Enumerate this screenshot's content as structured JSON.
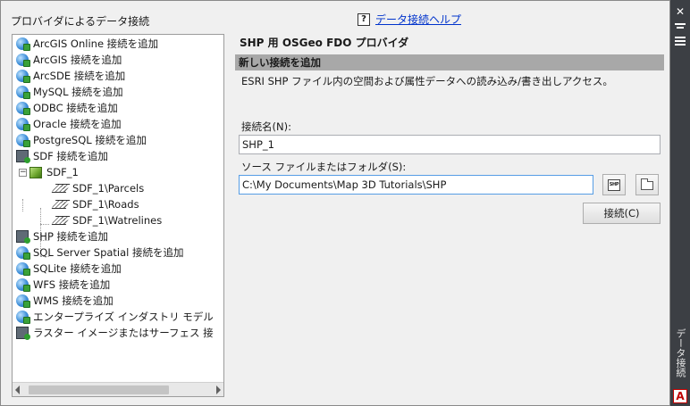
{
  "providers_label": "プロバイダによるデータ接続",
  "help_link": "データ接続ヘルプ",
  "tree": {
    "items": [
      {
        "label": "ArcGIS Online 接続を追加",
        "icon": "globe-icon"
      },
      {
        "label": "ArcGIS 接続を追加",
        "icon": "globe-icon"
      },
      {
        "label": "ArcSDE 接続を追加",
        "icon": "globe-icon"
      },
      {
        "label": "MySQL 接続を追加",
        "icon": "globe-icon"
      },
      {
        "label": "ODBC 接続を追加",
        "icon": "globe-icon"
      },
      {
        "label": "Oracle 接続を追加",
        "icon": "globe-icon"
      },
      {
        "label": "PostgreSQL 接続を追加",
        "icon": "globe-icon"
      },
      {
        "label": "SDF 接続を追加",
        "icon": "database-icon"
      },
      {
        "label": "SDF_1",
        "icon": "cube-icon"
      },
      {
        "label": "SDF_1\\Parcels",
        "icon": "layer-icon"
      },
      {
        "label": "SDF_1\\Roads",
        "icon": "layer-icon"
      },
      {
        "label": "SDF_1\\Watrelines",
        "icon": "layer-icon"
      },
      {
        "label": "SHP 接続を追加",
        "icon": "database-icon"
      },
      {
        "label": "SQL Server Spatial 接続を追加",
        "icon": "globe-icon"
      },
      {
        "label": "SQLite 接続を追加",
        "icon": "globe-icon"
      },
      {
        "label": "WFS 接続を追加",
        "icon": "globe-icon"
      },
      {
        "label": "WMS 接続を追加",
        "icon": "globe-icon"
      },
      {
        "label": "エンタープライズ インダストリ モデル",
        "icon": "globe-icon"
      },
      {
        "label": "ラスター イメージまたはサーフェス 接",
        "icon": "database-icon"
      }
    ],
    "expand_symbol": "−"
  },
  "provider_title": "SHP 用 OSGeo FDO プロバイダ",
  "section_title": "新しい接続を追加",
  "description": "ESRI SHP ファイル内の空間および属性データへの読み込み/書き出しアクセス。",
  "connection_name": {
    "label": "接続名(N):",
    "value": "SHP_1"
  },
  "source": {
    "label": "ソース ファイルまたはフォルダ(S):",
    "value": "C:\\My Documents\\Map 3D Tutorials\\SHP"
  },
  "shp_icon_text": "SHP",
  "connect_button": "接続(C)",
  "side_panel": {
    "title": "データ接続",
    "close_symbol": "✕",
    "logo_letter": "A"
  },
  "colors": {
    "panel_bg": "#f0f0f0",
    "section_bar": "#a8a8a8",
    "link": "#0033cc",
    "side_strip": "#3c3f44"
  }
}
